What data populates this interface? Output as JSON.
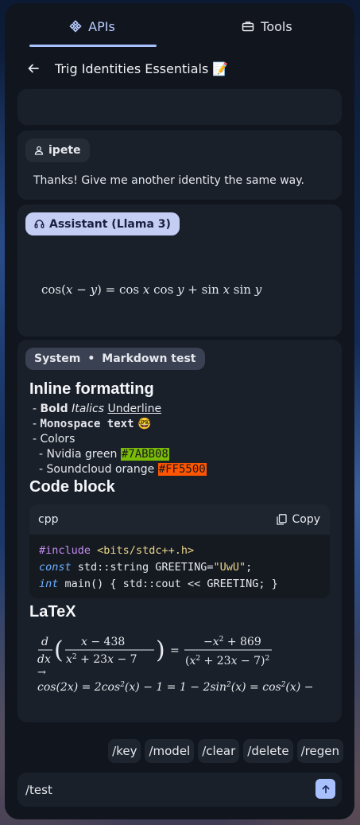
{
  "tabs": [
    {
      "label": "APIs",
      "icon": "api-icon",
      "active": true
    },
    {
      "label": "Tools",
      "icon": "toolbox-icon",
      "active": false
    }
  ],
  "header": {
    "title": "Trig Identities Essentials 📝"
  },
  "messages": {
    "user": {
      "author": "ipete",
      "text": "Thanks! Give me another identity the same way."
    },
    "assistant": {
      "author": "Assistant (Llama 3)"
    },
    "system": {
      "author": "System",
      "tag": "Markdown test",
      "inline_heading": "Inline formatting",
      "bold": "Bold",
      "italics": "Italics",
      "underline": "Underline",
      "monospace": "Monospace text",
      "emoji": "🤓",
      "colors_label": "Colors",
      "nvidia_label": "Nvidia green",
      "nvidia_hex": "#7ABB08",
      "soundcloud_label": "Soundcloud orange",
      "soundcloud_hex": "#FF5500",
      "code_heading": "Code block",
      "code_lang": "cpp",
      "copy_label": "Copy",
      "latex_heading": "LaTeX"
    }
  },
  "commands": [
    "/key",
    "/model",
    "/clear",
    "/delete",
    "/regen"
  ],
  "input": {
    "value": "/test"
  },
  "colors": {
    "accent": "#a9c0ff",
    "nvidia": "#7ABB08",
    "soundcloud": "#FF5500"
  }
}
